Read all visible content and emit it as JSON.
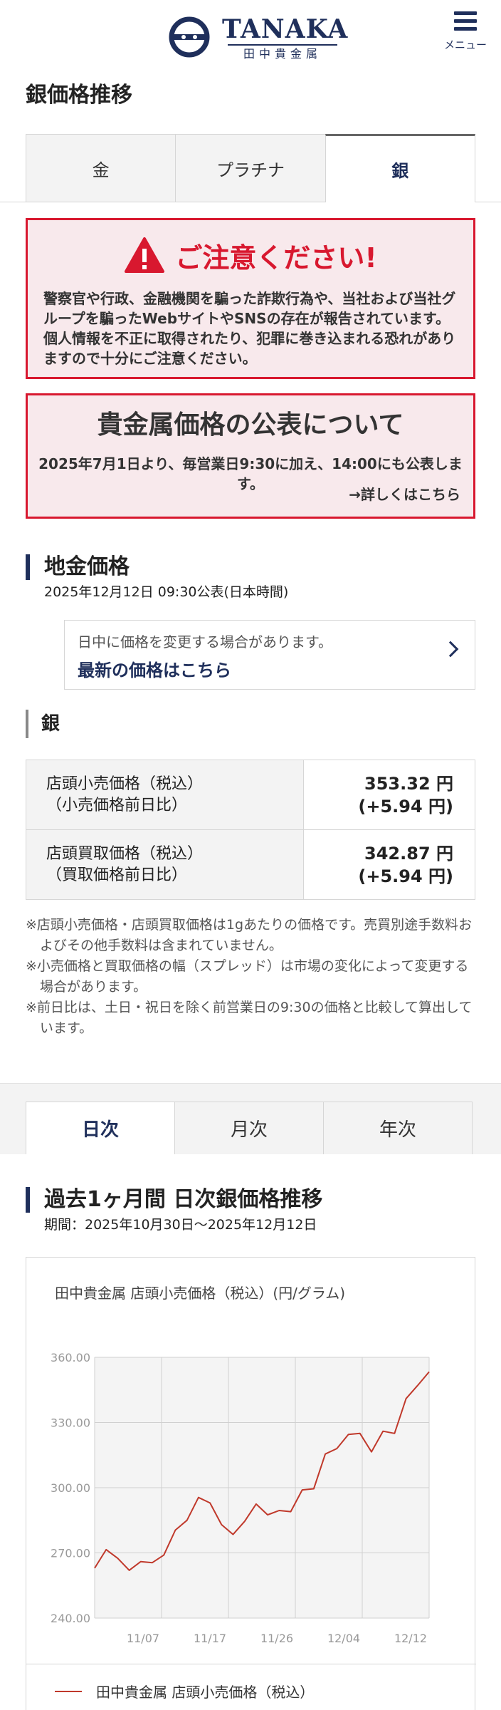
{
  "header": {
    "logo_en": "TANAKA",
    "logo_jp": "田中貴金属",
    "menu_label": "メニュー",
    "brand_color": "#1f2f5b"
  },
  "page_title": "銀価格推移",
  "metal_tabs": [
    {
      "label": "金",
      "active": false
    },
    {
      "label": "プラチナ",
      "active": false
    },
    {
      "label": "銀",
      "active": true
    }
  ],
  "warning": {
    "heading": "ご注意ください!",
    "body": "警察官や行政、金融機関を騙った詐欺行為や、当社および当社グループを騙ったWebサイトやSNSの存在が報告されています。個人情報を不正に取得されたり、犯罪に巻き込まれる恐れがありますので十分にご注意ください。",
    "accent": "#d8182f"
  },
  "announcement": {
    "title": "貴金属価格の公表について",
    "body": "2025年7月1日より、毎営業日9:30に加え、14:00にも公表します。",
    "link": "→詳しくはこちら"
  },
  "bullion": {
    "title": "地金価格",
    "published": "2025年12月12日 09:30公表(日本時間)"
  },
  "update_notice": {
    "note": "日中に価格を変更する場合があります。",
    "link": "最新の価格はこちら"
  },
  "silver_label": "銀",
  "prices": [
    {
      "label1": "店頭小売価格（税込）",
      "label2": "（小売価格前日比）",
      "value": "353.32 円",
      "change": "(+5.94 円)"
    },
    {
      "label1": "店頭買取価格（税込）",
      "label2": "（買取価格前日比）",
      "value": "342.87 円",
      "change": "(+5.94 円)"
    }
  ],
  "notes": [
    "※店頭小売価格・店頭買取価格は1gあたりの価格です。売買別途手数料およびその他手数料は含まれていません。",
    "※小売価格と買取価格の幅（スプレッド）は市場の変化によって変更する場合があります。",
    "※前日比は、土日・祝日を除く前営業日の9:30の価格と比較して算出しています。"
  ],
  "period_tabs": [
    {
      "label": "日次",
      "active": true
    },
    {
      "label": "月次",
      "active": false
    },
    {
      "label": "年次",
      "active": false
    }
  ],
  "chart_section": {
    "title": "過去1ヶ月間 日次銀価格推移",
    "period": "期間：2025年10月30日～2025年12月12日"
  },
  "chart_data": {
    "type": "line",
    "title": "田中貴金属 店頭小売価格（税込）(円/グラム)",
    "x_tick_labels": [
      "11/07",
      "11/17",
      "11/26",
      "12/04",
      "12/12"
    ],
    "y_tick_labels": [
      "360.00",
      "330.00",
      "300.00",
      "270.00",
      "240.00"
    ],
    "ylim": [
      240,
      360
    ],
    "grid": true,
    "legend_position": "bottom",
    "line_color": "#c0392b",
    "series": [
      {
        "name": "田中貴金属 店頭小売価格（税込）",
        "values": [
          263.0,
          271.5,
          267.5,
          262.0,
          266.0,
          265.5,
          269.0,
          280.5,
          285.0,
          295.5,
          293.0,
          283.0,
          278.5,
          284.5,
          292.5,
          287.5,
          289.5,
          289.0,
          299.0,
          299.5,
          315.5,
          318.0,
          324.5,
          325.0,
          316.5,
          326.0,
          325.0,
          341.0,
          347.0,
          353.32
        ]
      }
    ]
  }
}
